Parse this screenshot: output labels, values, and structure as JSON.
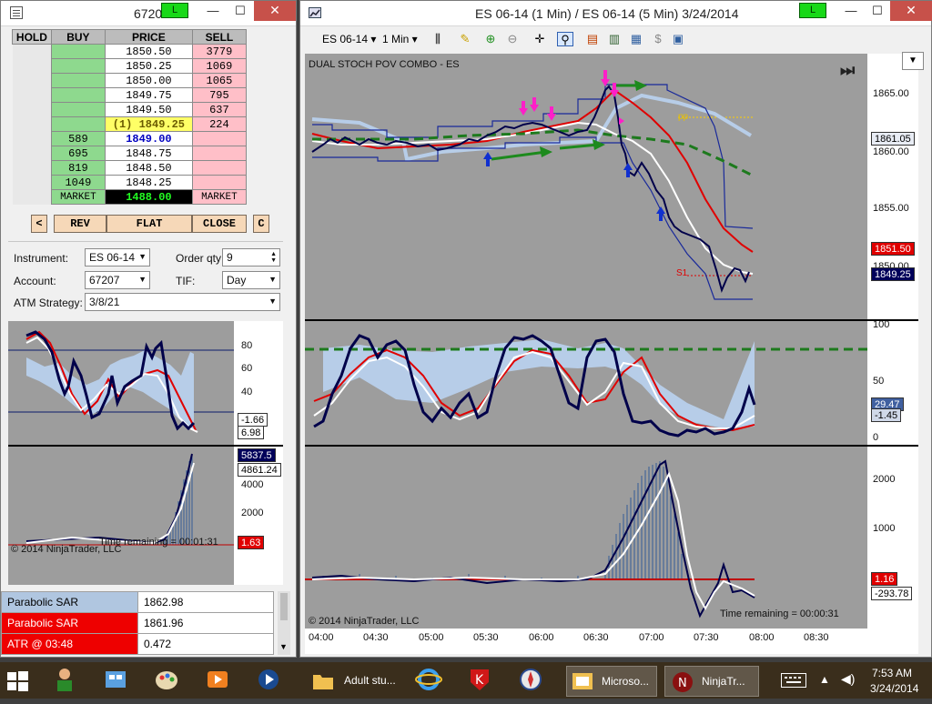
{
  "left_window": {
    "title": "6720",
    "status_badge": "L",
    "minimize": "—",
    "maximize": "☐",
    "close": "✕"
  },
  "ladder": {
    "headers": {
      "hold": "HOLD",
      "buy": "BUY",
      "price": "PRICE",
      "sell": "SELL"
    },
    "rows": [
      {
        "buy": "",
        "price": "1850.50",
        "sell": "3779"
      },
      {
        "buy": "",
        "price": "1850.25",
        "sell": "1069"
      },
      {
        "buy": "",
        "price": "1850.00",
        "sell": "1065"
      },
      {
        "buy": "",
        "price": "1849.75",
        "sell": "795"
      },
      {
        "buy": "",
        "price": "1849.50",
        "sell": "637"
      },
      {
        "buy": "",
        "price": "(1) 1849.25",
        "sell": "224"
      },
      {
        "buy": "589",
        "price": "1849.00",
        "sell": ""
      },
      {
        "buy": "695",
        "price": "1848.75",
        "sell": ""
      },
      {
        "buy": "819",
        "price": "1848.50",
        "sell": ""
      },
      {
        "buy": "1049",
        "price": "1848.25",
        "sell": ""
      }
    ],
    "market_buy": "MARKET",
    "market_value": "1488.00",
    "market_sell": "MARKET",
    "buttons": {
      "left": "<",
      "rev": "REV",
      "flat": "FLAT",
      "close": "CLOSE",
      "c": "C"
    }
  },
  "order_form": {
    "instrument_label": "Instrument:",
    "instrument_value": "ES 06-14",
    "order_qty_label": "Order qty:",
    "order_qty_value": "9",
    "account_label": "Account:",
    "account_value": "67207",
    "tif_label": "TIF:",
    "tif_value": "Day",
    "atm_label": "ATM Strategy:",
    "atm_value": "3/8/21"
  },
  "left_charts": {
    "stoch_ticks": [
      "80",
      "60",
      "40"
    ],
    "stoch_tags": [
      "-1.66",
      "6.98"
    ],
    "volume_ticks": [
      "4000",
      "2000"
    ],
    "volume_tags": [
      "5837.5",
      "4861.24",
      "1.63"
    ],
    "copyright": "© 2014 NinjaTrader, LLC",
    "time_remaining": "Time remaining = 00:01:31"
  },
  "sar_table": [
    {
      "name": "Parabolic SAR",
      "value": "1862.98"
    },
    {
      "name": "Parabolic SAR",
      "value": "1861.96"
    },
    {
      "name": "ATR @ 03:48",
      "value": "0.472"
    }
  ],
  "chart_window": {
    "title": "ES 06-14 (1 Min) / ES 06-14 (5 Min)  3/24/2014",
    "status_badge": "L",
    "toolbar_instrument": "ES 06-14",
    "toolbar_interval": "1 Min",
    "indicator_label": "DUAL STOCH POV COMBO - ES",
    "price_ticks": [
      "1865.00",
      "1860.00",
      "1855.00",
      "1850.00"
    ],
    "price_tags": [
      "1861.05",
      "1851.50",
      "1849.25"
    ],
    "pp_label": "pp",
    "s1_label": "S1",
    "stoch_ticks": [
      "100",
      "50",
      "0"
    ],
    "stoch_tags": [
      "29.47",
      "-1.45"
    ],
    "volume_ticks": [
      "2000",
      "1000"
    ],
    "volume_tags": [
      "1.16",
      "-293.78"
    ],
    "time_ticks": [
      "04:00",
      "04:30",
      "05:00",
      "05:30",
      "06:00",
      "06:30",
      "07:00",
      "07:30",
      "08:00",
      "08:30"
    ],
    "copyright": "© 2014 NinjaTrader, LLC",
    "time_remaining": "Time remaining = 00:00:31",
    "colors": {
      "panel_bg": "#9d9d9d",
      "price_line": "#00004a",
      "red_ma": "#e00000",
      "white_ma": "#ffffff",
      "envelope": "#b7cde8",
      "green_line": "#1d7a1d"
    }
  },
  "taskbar": {
    "items": [
      {
        "label": ""
      },
      {
        "label": ""
      },
      {
        "label": ""
      },
      {
        "label": ""
      },
      {
        "label": ""
      },
      {
        "label": "Adult stu..."
      },
      {
        "label": ""
      },
      {
        "label": ""
      },
      {
        "label": ""
      },
      {
        "label": "Microso..."
      },
      {
        "label": "NinjaTr..."
      }
    ],
    "clock_time": "7:53 AM",
    "clock_date": "3/24/2014"
  }
}
